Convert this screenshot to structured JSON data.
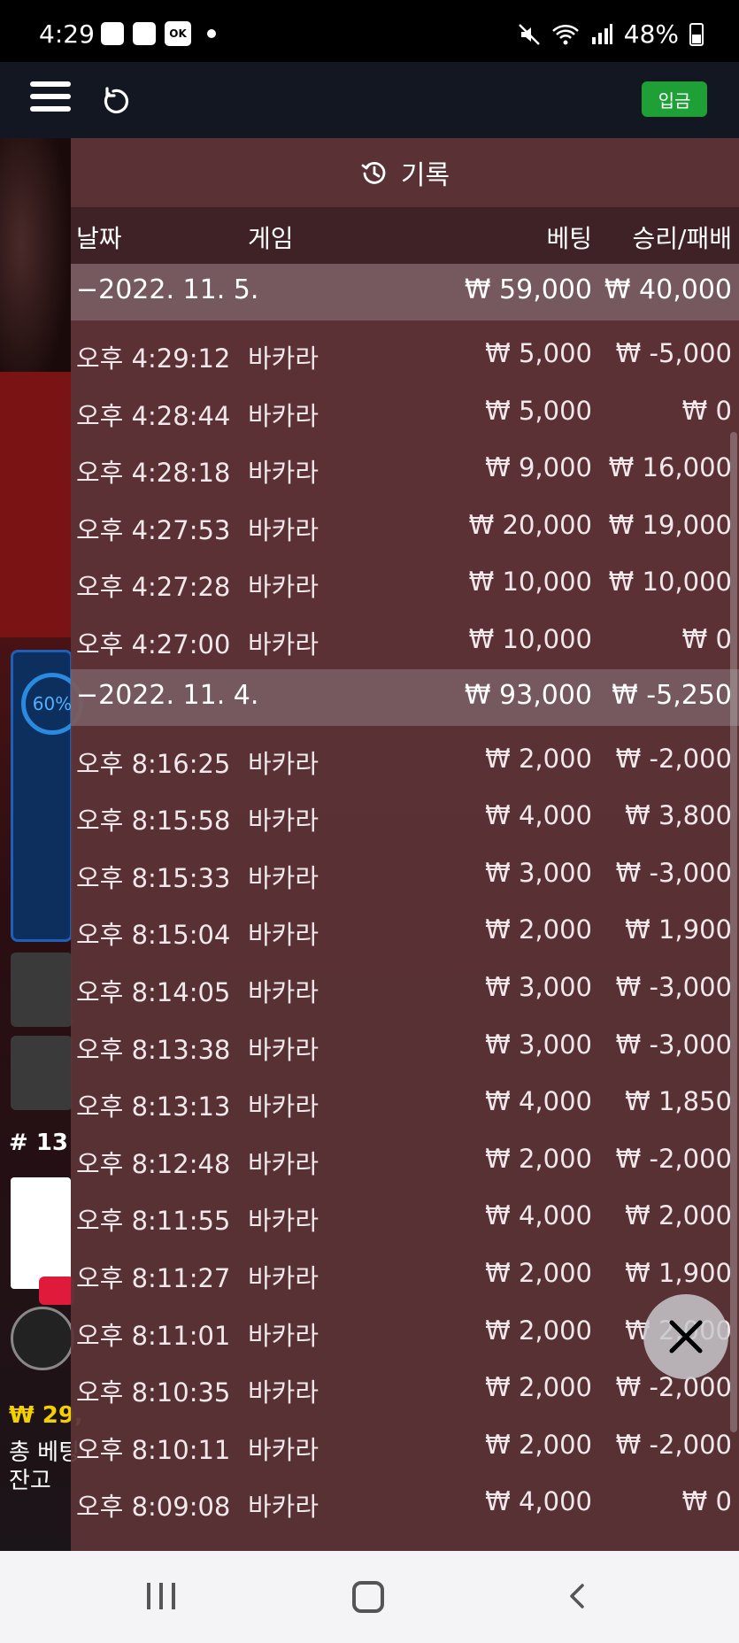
{
  "status_bar": {
    "time": "4:29",
    "ok_badge": "OK",
    "battery": "48%"
  },
  "toolbar": {
    "deposit_label": "입금"
  },
  "background": {
    "ring_percent": "60%",
    "round_label": "# 13",
    "bet_amount": "₩ 29,",
    "total_bet_label": "총 베팅",
    "balance_label": "잔고"
  },
  "history": {
    "title": "기록",
    "columns": {
      "date": "날짜",
      "game": "게임",
      "bet": "베팅",
      "win_loss": "승리/패배"
    },
    "days": [
      {
        "date": "−2022. 11. 5.",
        "total_bet": "₩ 59,000",
        "total_win": "₩ 40,000",
        "rows": [
          {
            "time": "오후 4:29:12",
            "game": "바카라",
            "bet": "₩ 5,000",
            "win": "₩ -5,000"
          },
          {
            "time": "오후 4:28:44",
            "game": "바카라",
            "bet": "₩ 5,000",
            "win": "₩ 0"
          },
          {
            "time": "오후 4:28:18",
            "game": "바카라",
            "bet": "₩ 9,000",
            "win": "₩ 16,000"
          },
          {
            "time": "오후 4:27:53",
            "game": "바카라",
            "bet": "₩ 20,000",
            "win": "₩ 19,000"
          },
          {
            "time": "오후 4:27:28",
            "game": "바카라",
            "bet": "₩ 10,000",
            "win": "₩ 10,000"
          },
          {
            "time": "오후 4:27:00",
            "game": "바카라",
            "bet": "₩ 10,000",
            "win": "₩ 0"
          }
        ]
      },
      {
        "date": "−2022. 11. 4.",
        "total_bet": "₩ 93,000",
        "total_win": "₩ -5,250",
        "rows": [
          {
            "time": "오후 8:16:25",
            "game": "바카라",
            "bet": "₩ 2,000",
            "win": "₩ -2,000"
          },
          {
            "time": "오후 8:15:58",
            "game": "바카라",
            "bet": "₩ 4,000",
            "win": "₩ 3,800"
          },
          {
            "time": "오후 8:15:33",
            "game": "바카라",
            "bet": "₩ 3,000",
            "win": "₩ -3,000"
          },
          {
            "time": "오후 8:15:04",
            "game": "바카라",
            "bet": "₩ 2,000",
            "win": "₩ 1,900"
          },
          {
            "time": "오후 8:14:05",
            "game": "바카라",
            "bet": "₩ 3,000",
            "win": "₩ -3,000"
          },
          {
            "time": "오후 8:13:38",
            "game": "바카라",
            "bet": "₩ 3,000",
            "win": "₩ -3,000"
          },
          {
            "time": "오후 8:13:13",
            "game": "바카라",
            "bet": "₩ 4,000",
            "win": "₩ 1,850"
          },
          {
            "time": "오후 8:12:48",
            "game": "바카라",
            "bet": "₩ 2,000",
            "win": "₩ -2,000"
          },
          {
            "time": "오후 8:11:55",
            "game": "바카라",
            "bet": "₩ 4,000",
            "win": "₩ 2,000"
          },
          {
            "time": "오후 8:11:27",
            "game": "바카라",
            "bet": "₩ 2,000",
            "win": "₩ 1,900"
          },
          {
            "time": "오후 8:11:01",
            "game": "바카라",
            "bet": "₩ 2,000",
            "win": "₩ 2,000"
          },
          {
            "time": "오후 8:10:35",
            "game": "바카라",
            "bet": "₩ 2,000",
            "win": "₩ -2,000"
          },
          {
            "time": "오후 8:10:11",
            "game": "바카라",
            "bet": "₩ 2,000",
            "win": "₩ -2,000"
          },
          {
            "time": "오후 8:09:08",
            "game": "바카라",
            "bet": "₩ 4,000",
            "win": "₩ 0"
          }
        ]
      }
    ]
  },
  "colors": {
    "deposit_green": "#1ea036",
    "overlay": "#5c3438",
    "ring_blue": "#2a8ae0"
  },
  "icons": {
    "menu": "hamburger-icon",
    "reload": "reload-icon",
    "history": "history-clock-icon",
    "close": "close-x-icon"
  }
}
